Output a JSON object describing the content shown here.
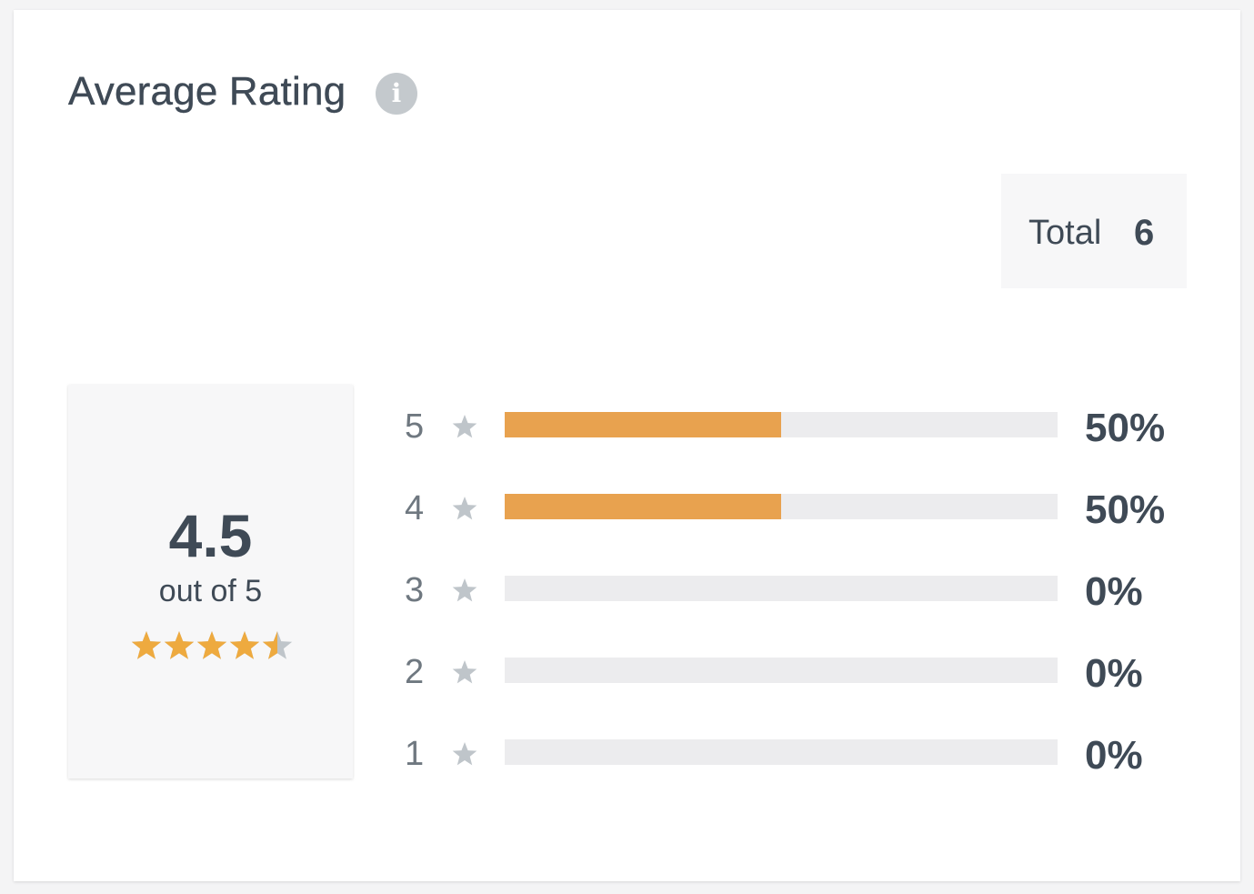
{
  "header": {
    "title": "Average Rating",
    "info_icon": "info-icon",
    "info_glyph": "i"
  },
  "total": {
    "label": "Total",
    "value": "6"
  },
  "average": {
    "value": "4.5",
    "subtitle": "out of 5",
    "rating": 4.5,
    "max": 5
  },
  "distribution": [
    {
      "stars": "5",
      "percent_label": "50%",
      "percent": 50
    },
    {
      "stars": "4",
      "percent_label": "50%",
      "percent": 50
    },
    {
      "stars": "3",
      "percent_label": "0%",
      "percent": 0
    },
    {
      "stars": "2",
      "percent_label": "0%",
      "percent": 0
    },
    {
      "stars": "1",
      "percent_label": "0%",
      "percent": 0
    }
  ],
  "colors": {
    "accent": "#e8a24f",
    "star_filled": "#eeaa3f",
    "star_empty": "#bfc5ca",
    "track": "#ececee",
    "text": "#3f4a56",
    "muted": "#6f7880"
  }
}
